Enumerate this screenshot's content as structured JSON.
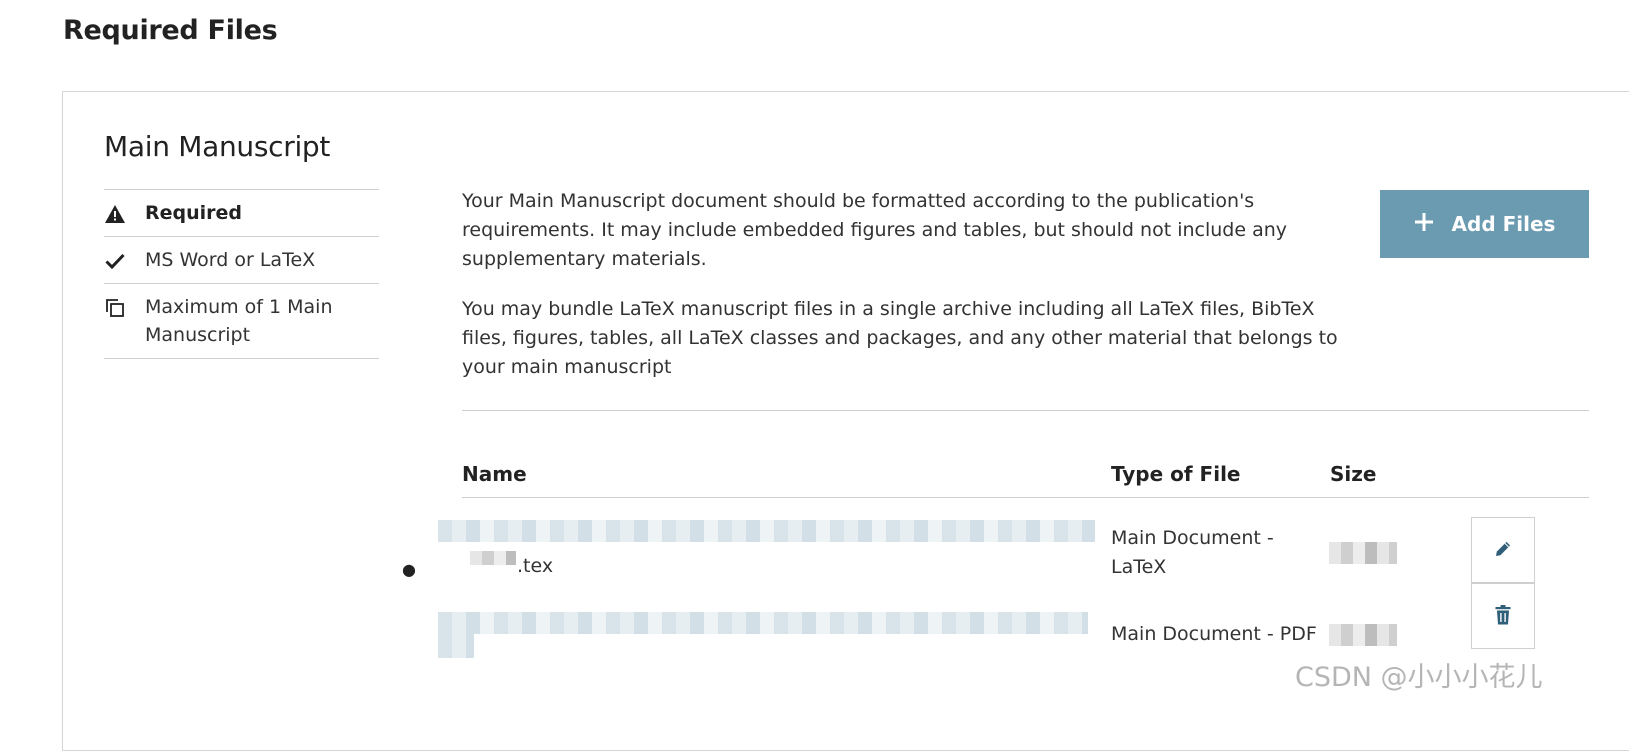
{
  "page": {
    "title": "Required Files"
  },
  "section": {
    "title": "Main Manuscript",
    "requirements": [
      {
        "icon": "warning-icon",
        "label": "Required"
      },
      {
        "icon": "check-icon",
        "label": "MS Word or LaTeX"
      },
      {
        "icon": "copy-icon",
        "label": "Maximum of 1 Main Manuscript"
      }
    ],
    "description": [
      "Your Main Manuscript document should be formatted according to the publication's requirements. It may include embedded figures and tables, but should not include any supplementary materials.",
      "You may bundle LaTeX manuscript files in a single archive including all LaTeX files, BibTeX files, figures, tables, all LaTeX classes and packages, and any other material that belongs to your main manuscript"
    ],
    "add_button": {
      "icon": "plus-icon",
      "label": "Add Files"
    }
  },
  "table": {
    "headers": {
      "name": "Name",
      "type": "Type of File",
      "size": "Size"
    },
    "rows": [
      {
        "name_suffix": ".tex",
        "type": "Main Document - LaTeX",
        "size": ""
      },
      {
        "name_suffix": "",
        "type": "Main Document - PDF",
        "size": ""
      }
    ]
  },
  "actions": {
    "edit_icon": "pencil-icon",
    "delete_icon": "trash-icon"
  },
  "watermark": "CSDN @小小小花儿",
  "colors": {
    "accent": "#6b9bb1",
    "icon": "#2f5f78"
  }
}
